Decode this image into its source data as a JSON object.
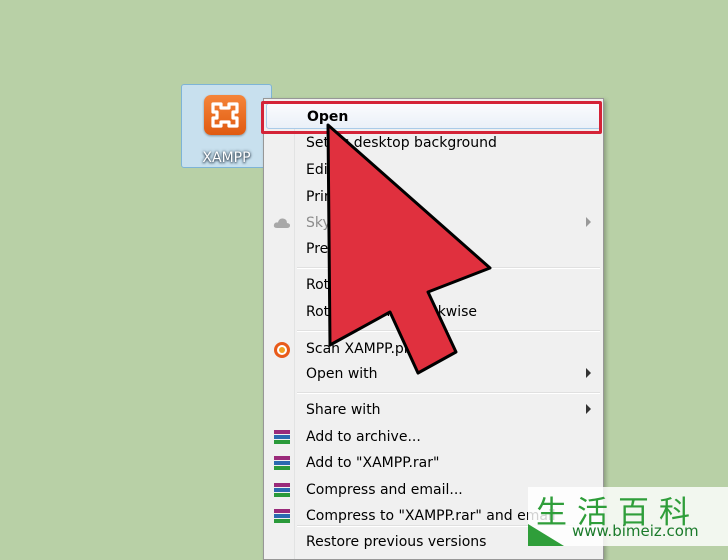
{
  "desktop": {
    "icon_label": "XAMPP"
  },
  "context_menu": {
    "items": [
      {
        "label": "Open",
        "state": "selected"
      },
      {
        "label": "Set as desktop background"
      },
      {
        "label": "Edit"
      },
      {
        "label": "Print"
      },
      {
        "label": "SkyDrive",
        "state": "disabled",
        "icon": "cloud-icon"
      },
      {
        "label": "Preview"
      },
      {
        "label": "Rotate clockwise"
      },
      {
        "label": "Rotate counterclockwise"
      },
      {
        "label": "Scan XAMPP.png",
        "icon": "antivirus-icon"
      },
      {
        "label": "Open with"
      },
      {
        "label": "Share with"
      },
      {
        "label": "Add to archive...",
        "icon": "winrar-icon"
      },
      {
        "label": "Add to \"XAMPP.rar\"",
        "icon": "winrar-icon"
      },
      {
        "label": "Compress and email...",
        "icon": "winrar-icon"
      },
      {
        "label": "Compress to \"XAMPP.rar\" and email",
        "icon": "winrar-icon"
      },
      {
        "label": "Restore previous versions"
      }
    ]
  },
  "watermark": {
    "title": "生活百科",
    "url": "www.bimeiz.com"
  },
  "colors": {
    "desktop_bg": "#b8d0a6",
    "highlight_red": "#d42337",
    "pointer_red": "#e0303e"
  }
}
